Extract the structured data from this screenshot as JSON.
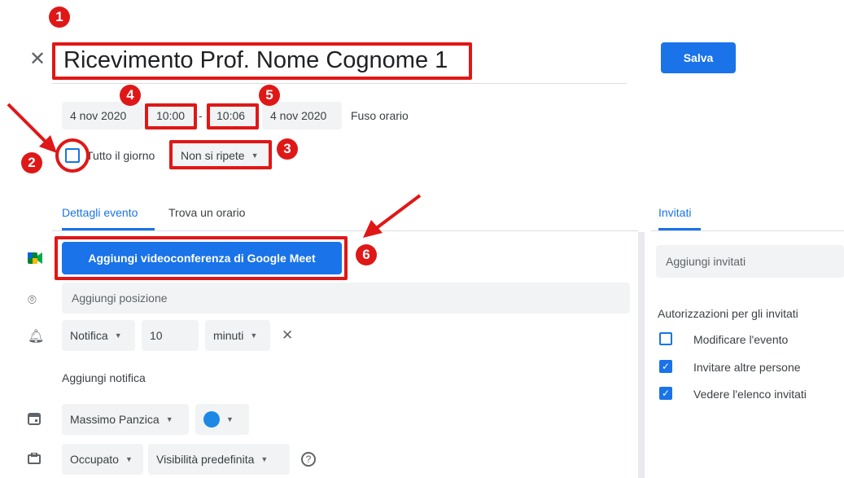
{
  "header": {
    "close_icon": "close-icon",
    "title": "Ricevimento Prof. Nome Cognome 1",
    "save_label": "Salva"
  },
  "datetime": {
    "start_date": "4 nov 2020",
    "start_time": "10:00",
    "separator": "-",
    "end_time": "10:06",
    "end_date": "4 nov 2020",
    "timezone_label": "Fuso orario",
    "all_day_label": "Tutto il giorno",
    "repeat_label": "Non si ripete"
  },
  "tabs": [
    {
      "label": "Dettagli evento",
      "active": true
    },
    {
      "label": "Trova un orario",
      "active": false
    }
  ],
  "details": {
    "meet_button": "Aggiungi videoconferenza di Google Meet",
    "location_placeholder": "Aggiungi posizione",
    "notification_type": "Notifica",
    "notification_value": "10",
    "notification_unit": "minuti",
    "add_notification": "Aggiungi notifica",
    "calendar_owner": "Massimo Panzica",
    "calendar_color": "#1e88e5",
    "busy_status": "Occupato",
    "visibility": "Visibilità predefinita"
  },
  "guests": {
    "tab_label": "Invitati",
    "add_placeholder": "Aggiungi invitati",
    "permissions_title": "Autorizzazioni per gli invitati",
    "permissions": [
      {
        "label": "Modificare l'evento",
        "checked": false
      },
      {
        "label": "Invitare altre persone",
        "checked": true
      },
      {
        "label": "Vedere l'elenco invitati",
        "checked": true
      }
    ]
  },
  "annotations": {
    "badges": [
      "1",
      "2",
      "3",
      "4",
      "5",
      "6"
    ],
    "color": "#e01717"
  },
  "colors": {
    "accent": "#1a73e8",
    "annotation_red": "#e01717"
  }
}
